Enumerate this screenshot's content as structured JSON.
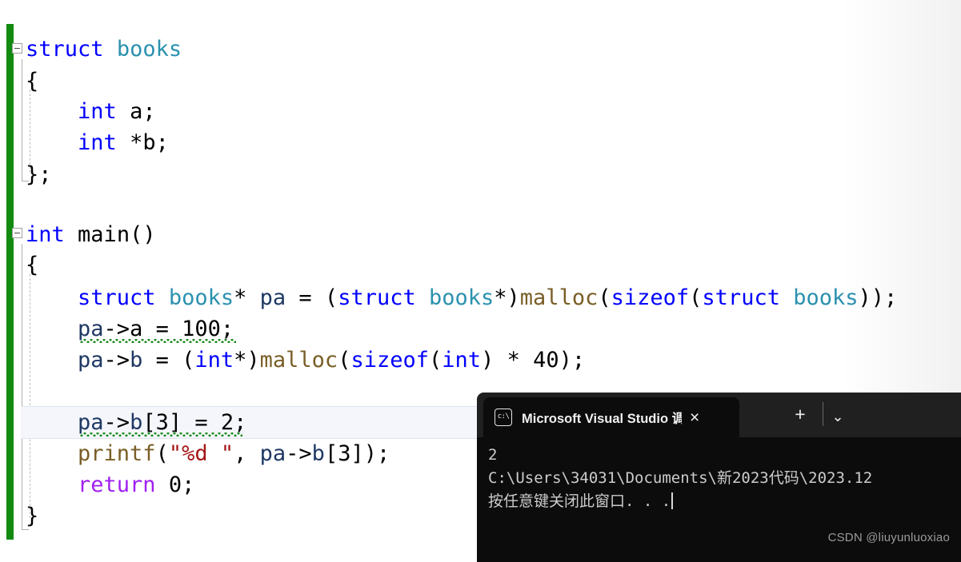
{
  "editor": {
    "change_bar_color": "#108b10",
    "current_line_highlight_color": "#f4f6fb",
    "squiggle_color": "#1a8a1a",
    "code_lines": [
      {
        "id": "l1",
        "text": "struct books"
      },
      {
        "id": "l2",
        "text": "{"
      },
      {
        "id": "l3",
        "text": "    int a;"
      },
      {
        "id": "l4",
        "text": "    int *b;"
      },
      {
        "id": "l5",
        "text": "};"
      },
      {
        "id": "l6",
        "text": ""
      },
      {
        "id": "l7",
        "text": "int main()"
      },
      {
        "id": "l8",
        "text": "{"
      },
      {
        "id": "l9",
        "text": "    struct books* pa = (struct books*)malloc(sizeof(struct books));"
      },
      {
        "id": "l10",
        "text": "    pa->a = 100;"
      },
      {
        "id": "l11",
        "text": "    pa->b = (int*)malloc(sizeof(int) * 40);"
      },
      {
        "id": "l12",
        "text": ""
      },
      {
        "id": "l13",
        "text": "    pa->b[3] = 2;"
      },
      {
        "id": "l14",
        "text": "    printf(\"%d \", pa->b[3]);"
      },
      {
        "id": "l15",
        "text": "    return 0;"
      },
      {
        "id": "l16",
        "text": "}"
      }
    ],
    "tokens": {
      "kw_struct": "struct",
      "kw_int": "int",
      "type_books": "books",
      "fn_malloc": "malloc",
      "fn_sizeof": "sizeof",
      "fn_printf": "printf",
      "fn_main": "main",
      "ctl_return": "return",
      "str_format": "\"%d \"",
      "var_pa": "pa",
      "var_a": "a",
      "var_b": "b",
      "num_100": "100",
      "num_40": "40",
      "num_3": "3",
      "num_2": "2",
      "num_0": "0"
    },
    "fold_markers": [
      {
        "id": "fold-struct-books",
        "label": "-"
      },
      {
        "id": "fold-int-main",
        "label": "-"
      }
    ]
  },
  "console": {
    "tab": {
      "title": "Microsoft Visual Studio 调试控",
      "icon": "terminal-icon",
      "close_label": "×"
    },
    "titlebar": {
      "new_tab_label": "+",
      "menu_label": "⌄"
    },
    "output_lines": [
      "2",
      "C:\\Users\\34031\\Documents\\新2023代码\\2023.12",
      "按任意键关闭此窗口. . ."
    ],
    "background_color": "#0c0c0c",
    "titlebar_color": "#202020"
  },
  "watermark": {
    "text": "CSDN @liuyunluoxiao"
  }
}
